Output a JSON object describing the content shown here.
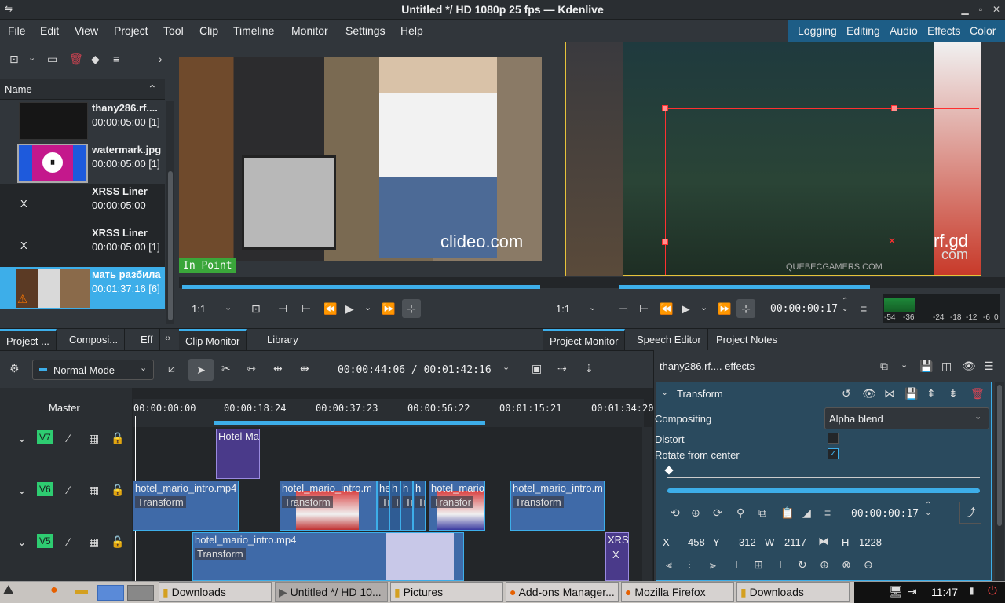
{
  "window": {
    "title": "Untitled */ HD 1080p 25 fps — Kdenlive"
  },
  "menu": [
    "File",
    "Edit",
    "View",
    "Project",
    "Tool",
    "Clip",
    "Timeline",
    "Monitor",
    "Settings",
    "Help"
  ],
  "workspaces": [
    "Logging",
    "Editing",
    "Audio",
    "Effects",
    "Color"
  ],
  "bin": {
    "header": "Name",
    "items": [
      {
        "name": "thany286.rf....",
        "duration": "00:00:05:00 [1]",
        "mark": ""
      },
      {
        "name": "watermark.jpg",
        "duration": "00:00:05:00 [1]",
        "mark": ""
      },
      {
        "name": "XRSS Liner",
        "duration": "00:00:05:00",
        "mark": "X"
      },
      {
        "name": "XRSS Liner",
        "duration": "00:00:05:00 [1]",
        "mark": "X"
      },
      {
        "name": "мать разбила",
        "duration": "00:01:37:16 [6]",
        "mark": ""
      }
    ],
    "tabs": [
      "Project ...",
      "Composi...",
      "Eff"
    ]
  },
  "clip_monitor": {
    "watermark": "clideo.com",
    "in_point": "In Point",
    "zoom": "1:1",
    "tabs": [
      "Clip Monitor",
      "Library"
    ]
  },
  "project_monitor": {
    "zoom": "1:1",
    "timecode": "00:00:00:17",
    "overlay_text_a": "rf.gd",
    "overlay_text_b": "com",
    "overlay_text_c": "QUEBECGAMERS.COM",
    "tabs": [
      "Project Monitor",
      "Speech Editor",
      "Project Notes"
    ],
    "meter_labels": [
      "-54",
      "-36",
      "-24",
      "-18",
      "-12",
      "-6",
      "0"
    ]
  },
  "timeline": {
    "mode": "Normal Mode",
    "timecode": "00:00:44:06 / 00:01:42:16",
    "master": "Master",
    "ruler": [
      "00:00:00:00",
      "00:00:18:24",
      "00:00:37:23",
      "00:00:56:22",
      "00:01:15:21",
      "00:01:34:20"
    ],
    "tracks": [
      "V7",
      "V6",
      "V5"
    ],
    "clips": {
      "v7": "Hotel Ma",
      "v6a": "hotel_mario_intro.mp4",
      "v6b": "hotel_mario_intro.m",
      "v6c": "hotel_mario_intro.m",
      "v6d": "hotel_mario_intro.m",
      "v6s": [
        "he",
        "h",
        "h",
        "h",
        "h"
      ],
      "v5a": "hotel_mario_intro.mp4",
      "v5x": "XRSS",
      "v5xs": "X",
      "tag": "Transform",
      "tag_short": "Transfor",
      "tag_tiny": "Tr"
    }
  },
  "effects": {
    "title": "thany286.rf.... effects",
    "effect_name": "Transform",
    "compositing_label": "Compositing",
    "compositing_value": "Alpha blend",
    "distort_label": "Distort",
    "rotate_label": "Rotate from center",
    "timecode": "00:00:00:17",
    "x_label": "X",
    "x": "458",
    "y_label": "Y",
    "y": "312",
    "w_label": "W",
    "w": "2117",
    "h_label": "H",
    "h": "1228"
  },
  "taskbar": {
    "items": [
      "Downloads",
      "Untitled */ HD 10...",
      "Pictures",
      "Add-ons Manager...",
      "Mozilla Firefox",
      "Downloads"
    ],
    "clock": "11:47"
  },
  "colors": {
    "accent": "#3daee9",
    "bg": "#232629",
    "panel": "#31363b",
    "clip": "#3f6aa8",
    "track_label": "#2ecc71"
  }
}
